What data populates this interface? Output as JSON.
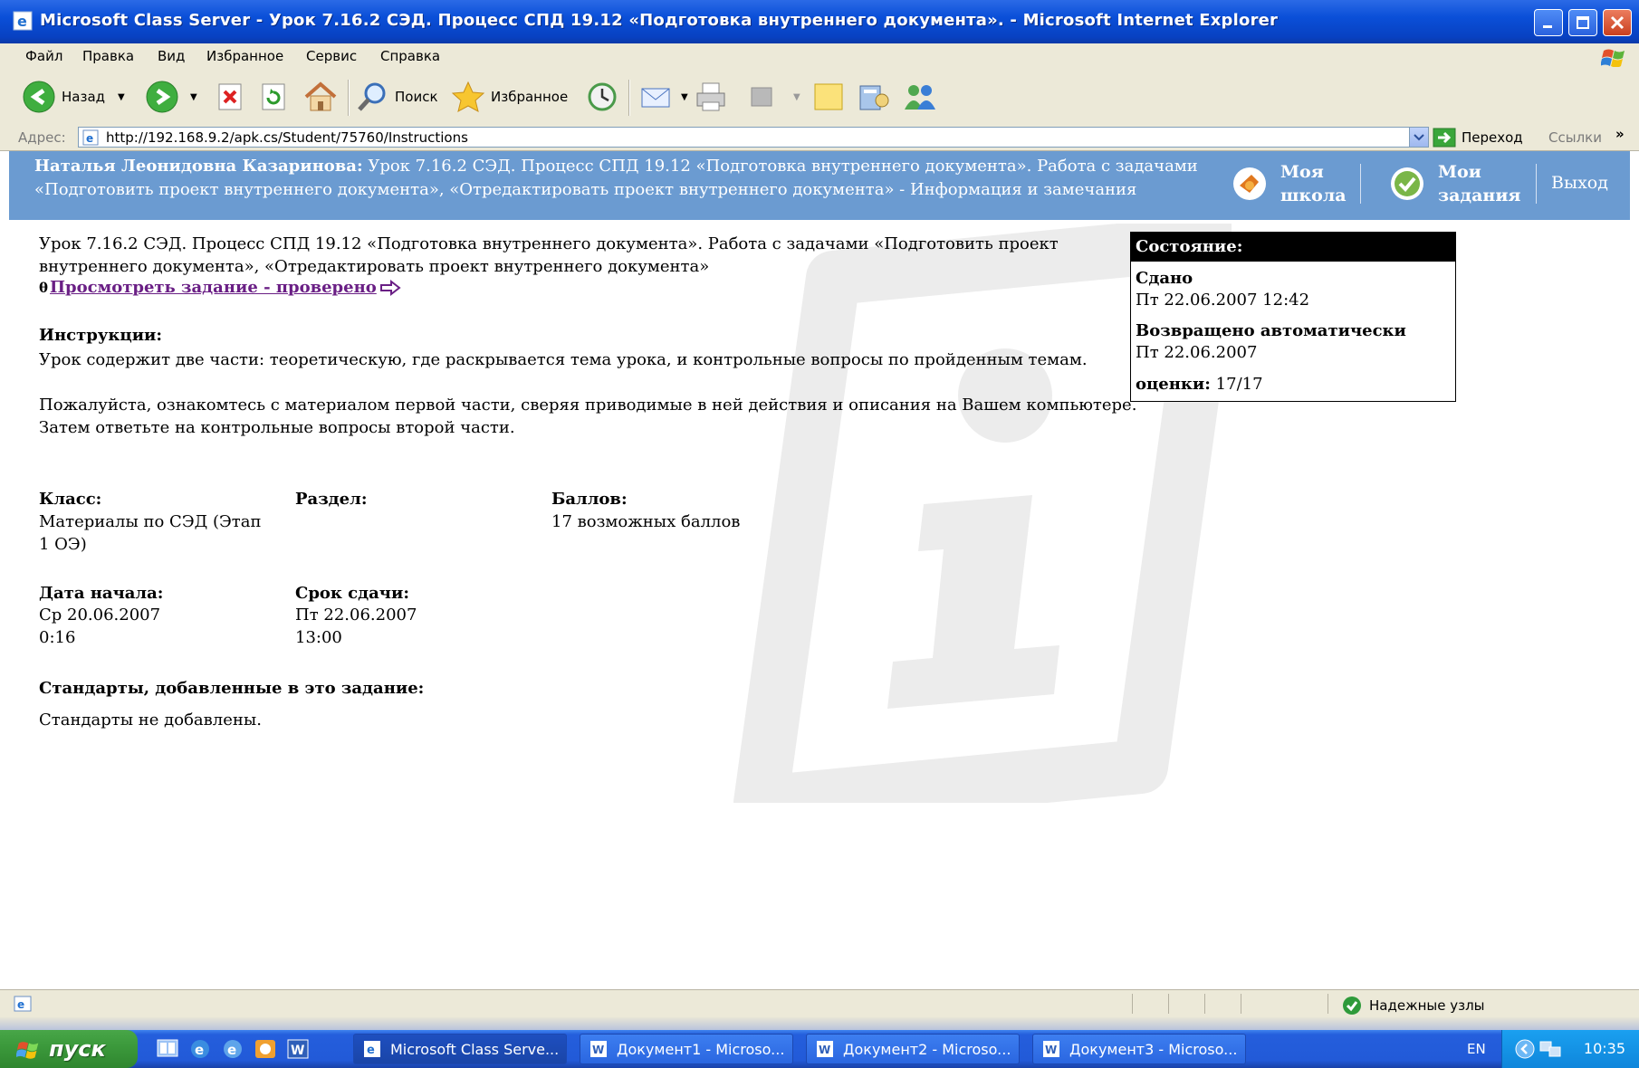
{
  "window": {
    "title": "Microsoft Class Server - Урок 7.16.2 СЭД. Процесс СПД 19.12 «Подготовка внутреннего документа». - Microsoft Internet Explorer"
  },
  "menu": [
    "Файл",
    "Правка",
    "Вид",
    "Избранное",
    "Сервис",
    "Справка"
  ],
  "toolbar": {
    "back": "Назад",
    "search": "Поиск",
    "favorites": "Избранное"
  },
  "address": {
    "label": "Адрес:",
    "url": "http://192.168.9.2/apk.cs/Student/75760/Instructions",
    "go": "Переход",
    "links": "Ссылки",
    "more": "»"
  },
  "header": {
    "user": "Наталья Леонидовна Казаринова:",
    "text": " Урок 7.16.2 СЭД. Процесс СПД 19.12 «Подготовка внутреннего документа». Работа с задачами «Подготовить проект внутреннего документа», «Отредактировать проект внутреннего документа» - Информация и замечания",
    "my_school_1": "Моя",
    "my_school_2": "школа",
    "my_tasks_1": "Мои",
    "my_tasks_2": "задания",
    "exit": "Выход"
  },
  "content": {
    "lesson_title": "Урок 7.16.2 СЭД. Процесс СПД 19.12 «Подготовка внутреннего документа». Работа с задачами «Подготовить проект внутреннего документа», «Отредактировать проект внутреннего документа»",
    "lock_glyph": "θ",
    "view_link": "Просмотреть задание - проверено",
    "instructions_label": "Инструкции:",
    "instructions_p1": "Урок содержит две части: теоретическую, где раскрывается тема урока, и контрольные вопросы по пройденным темам.",
    "instructions_p2": "Пожалуйста, ознакомтесь с материалом первой части, сверяя приводимые в ней действия и описания на Вашем компьютере. Затем ответьте на контрольные вопросы второй части.",
    "class_label": "Класс:",
    "class_value_1": "Материалы по СЭД (Этап",
    "class_value_2": "1 ОЭ)",
    "section_label": "Раздел:",
    "points_label": "Баллов:",
    "points_value": "17 возможных баллов",
    "start_label": "Дата начала:",
    "start_value_1": "Ср 20.06.2007",
    "start_value_2": "0:16",
    "due_label": "Срок сдачи:",
    "due_value_1": "Пт 22.06.2007",
    "due_value_2": "13:00",
    "standards_label": "Стандарты, добавленные в это задание:",
    "standards_value": "Стандарты не добавлены."
  },
  "status_box": {
    "title": "Состояние:",
    "submitted_label": "Сдано",
    "submitted_date": "Пт 22.06.2007 12:42",
    "returned_label": "Возвращено автоматически",
    "returned_date": "Пт 22.06.2007",
    "grade_label": "оценки:",
    "grade_value": "17/17"
  },
  "statusbar": {
    "zone": "Надежные узлы"
  },
  "taskbar": {
    "start": "пуск",
    "tasks": [
      "Microsoft Class Serve...",
      "Документ1 - Microso...",
      "Документ2 - Microso...",
      "Документ3 - Microso..."
    ],
    "lang": "EN",
    "clock": "10:35"
  },
  "colors": {
    "header_band": "#6b9bd1",
    "link_visited": "#6a1f85",
    "title_bar": "#0a4fd8"
  }
}
